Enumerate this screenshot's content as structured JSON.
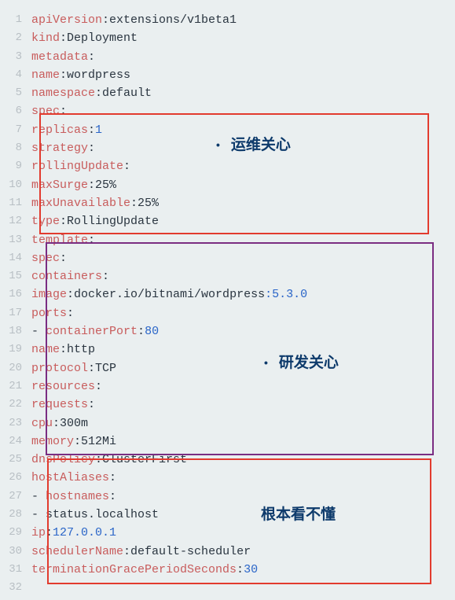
{
  "labels": {
    "ops": "运维关心",
    "dev": "研发关心",
    "confused": "根本看不懂"
  },
  "lines": [
    {
      "n": 1,
      "indent": 0,
      "type": "kv",
      "key": "apiVersion",
      "value": "extensions/v1beta1"
    },
    {
      "n": 2,
      "indent": 0,
      "type": "kv",
      "key": "kind",
      "value": "Deployment"
    },
    {
      "n": 3,
      "indent": 0,
      "type": "k",
      "key": "metadata"
    },
    {
      "n": 4,
      "indent": 1,
      "type": "kv",
      "key": "name",
      "value": "wordpress"
    },
    {
      "n": 5,
      "indent": 1,
      "type": "kv",
      "key": "namespace",
      "value": "default"
    },
    {
      "n": 6,
      "indent": 0,
      "type": "k",
      "key": "spec"
    },
    {
      "n": 7,
      "indent": 1,
      "type": "kvnum",
      "key": "replicas",
      "value": "1"
    },
    {
      "n": 8,
      "indent": 1,
      "type": "k",
      "key": "strategy"
    },
    {
      "n": 9,
      "indent": 2,
      "type": "k",
      "key": "rollingUpdate"
    },
    {
      "n": 10,
      "indent": 3,
      "type": "kv",
      "key": "maxSurge",
      "value": "25%"
    },
    {
      "n": 11,
      "indent": 3,
      "type": "kv",
      "key": "maxUnavailable",
      "value": "25%"
    },
    {
      "n": 12,
      "indent": 2,
      "type": "kv",
      "key": "type",
      "value": "RollingUpdate"
    },
    {
      "n": 13,
      "indent": 1,
      "type": "k",
      "key": "template"
    },
    {
      "n": 14,
      "indent": 2,
      "type": "k",
      "key": "spec"
    },
    {
      "n": 15,
      "indent": 3,
      "type": "k",
      "key": "containers"
    },
    {
      "n": 16,
      "indent": 4,
      "type": "image",
      "key": "image",
      "value_pre": "docker.io/bitnami/wordpress",
      "value_tag": ":5.3.0"
    },
    {
      "n": 17,
      "indent": 4,
      "type": "k",
      "key": "ports"
    },
    {
      "n": 18,
      "indent": 4,
      "type": "dkvnum",
      "key": "containerPort",
      "value": "80"
    },
    {
      "n": 19,
      "indent": 5,
      "type": "kv",
      "key": "name",
      "value": "http"
    },
    {
      "n": 20,
      "indent": 5,
      "type": "kv",
      "key": "protocol",
      "value": "TCP"
    },
    {
      "n": 21,
      "indent": 4,
      "type": "k",
      "key": "resources"
    },
    {
      "n": 22,
      "indent": 5,
      "type": "k",
      "key": "requests"
    },
    {
      "n": 23,
      "indent": 6,
      "type": "kv",
      "key": "cpu",
      "value": "300m"
    },
    {
      "n": 24,
      "indent": 6,
      "type": "kv",
      "key": "memory",
      "value": "512Mi"
    },
    {
      "n": 25,
      "indent": 3,
      "type": "kv",
      "key": "dnsPolicy",
      "value": "ClusterFirst"
    },
    {
      "n": 26,
      "indent": 3,
      "type": "k",
      "key": "hostAliases"
    },
    {
      "n": 27,
      "indent": 3,
      "type": "dk",
      "key": "hostnames"
    },
    {
      "n": 28,
      "indent": 4,
      "type": "dval",
      "value": "status.localhost"
    },
    {
      "n": 29,
      "indent": 4,
      "type": "kvnum",
      "key": "ip",
      "value": "127.0.0.1"
    },
    {
      "n": 30,
      "indent": 3,
      "type": "kv",
      "key": "schedulerName",
      "value": "default-scheduler"
    },
    {
      "n": 31,
      "indent": 3,
      "type": "kvnum",
      "key": "terminationGracePeriodSeconds",
      "value": "30"
    },
    {
      "n": 32,
      "indent": 0,
      "type": "empty"
    }
  ]
}
